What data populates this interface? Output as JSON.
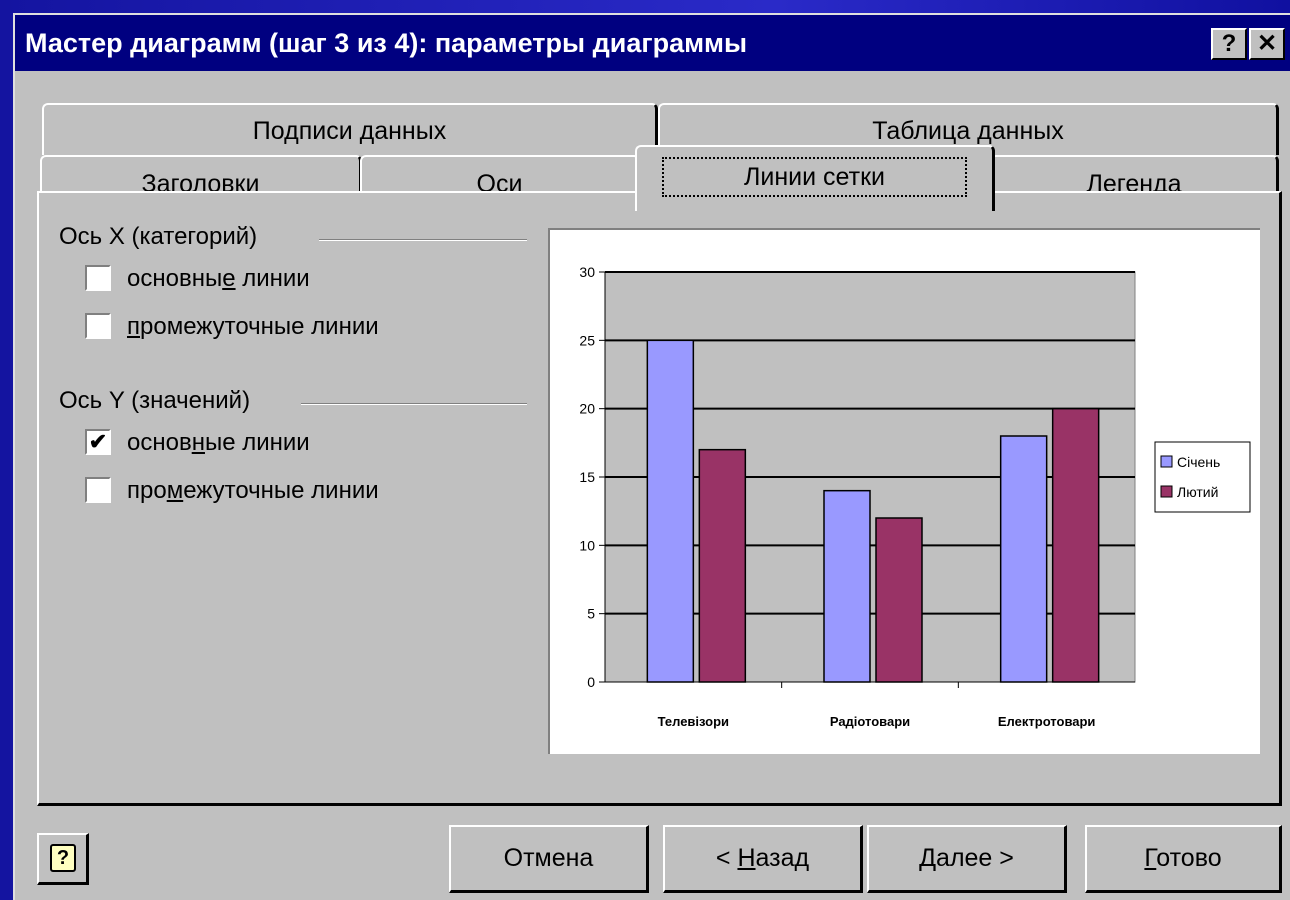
{
  "window": {
    "title": "Мастер диаграмм (шаг 3 из 4): параметры диаграммы",
    "help_glyph": "?",
    "close_glyph": "✕"
  },
  "tabs": {
    "back_row": [
      {
        "label": "Подписи данных"
      },
      {
        "label": "Таблица данных"
      }
    ],
    "front_row": [
      {
        "label": "Заголовки"
      },
      {
        "label": "Оси"
      },
      {
        "label": "Линии сетки",
        "active": true
      },
      {
        "label": "Легенда"
      }
    ]
  },
  "gridlines": {
    "x_group": {
      "title": "Ось X (категорий)",
      "major": {
        "pre": "основны",
        "accel": "е",
        "post": " линии",
        "checked": false
      },
      "minor": {
        "pre": "",
        "accel": "п",
        "post": "ромежуточные линии",
        "checked": false
      }
    },
    "y_group": {
      "title": "Ось Y (значений)",
      "major": {
        "pre": "основ",
        "accel": "н",
        "post": "ые линии",
        "checked": true
      },
      "minor": {
        "pre": "про",
        "accel": "м",
        "post": "ежуточные линии",
        "checked": false
      }
    },
    "check_glyph": "✔"
  },
  "chart_data": {
    "type": "bar",
    "categories": [
      "Телевізори",
      "Радіотовари",
      "Електротовари"
    ],
    "series": [
      {
        "name": "Січень",
        "values": [
          25,
          14,
          18
        ],
        "color": "#9999ff"
      },
      {
        "name": "Лютий",
        "values": [
          17,
          12,
          20
        ],
        "color": "#993366"
      }
    ],
    "ylim": [
      0,
      30
    ],
    "yticks": [
      "0",
      "5",
      "10",
      "15",
      "20",
      "25",
      "30"
    ],
    "grid": "y-major",
    "plot_area_color": "#c0c0c0",
    "legend_position": "right"
  },
  "buttons": {
    "help_glyph": "?",
    "cancel": "Отмена",
    "back": {
      "pre": "< ",
      "accel": "Н",
      "post": "азад"
    },
    "next": "Далее >",
    "finish": {
      "pre": "",
      "accel": "Г",
      "post": "отово"
    }
  }
}
